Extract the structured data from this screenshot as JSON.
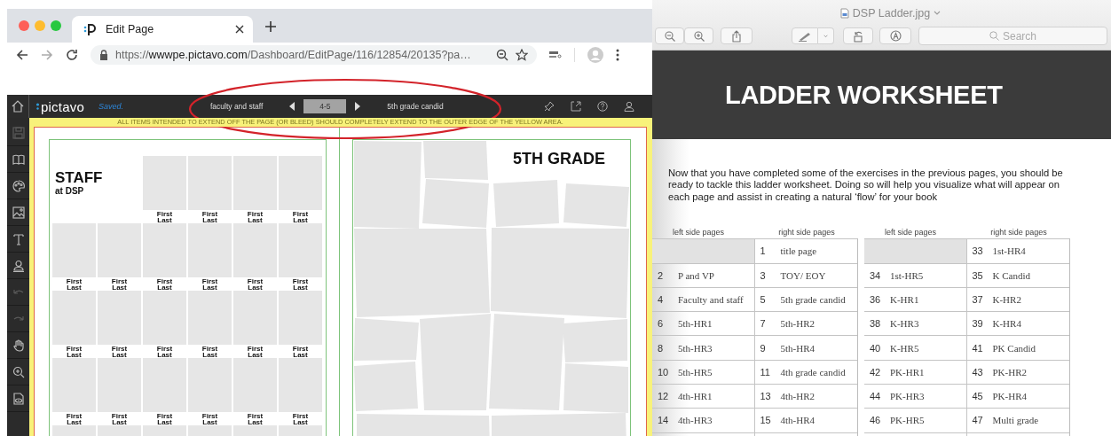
{
  "browser": {
    "tabs": [
      {
        "title": "Edit Page",
        "selected": true
      }
    ],
    "url": {
      "scheme": "https://",
      "host": "wwwpe.pictavo.com",
      "path": "/Dashboard/EditPage/116/12854/20135?pa…"
    }
  },
  "editor": {
    "logo": "pictavo",
    "status": "Saved.",
    "prev_page": "faculty and staff",
    "page": "4-5",
    "next_page": "5th grade candid",
    "bleed_notice": "ALL ITEMS INTENDED TO EXTEND OFF THE PAGE (OR BLEED) SHOULD COMPLETELY EXTEND TO THE OUTER EDGE OF THE YELLOW AREA.",
    "tools": [
      {
        "kind": "save",
        "disabled": true
      },
      {
        "kind": "book",
        "disabled": false
      },
      {
        "kind": "palette",
        "disabled": false
      },
      {
        "kind": "image",
        "disabled": false
      },
      {
        "kind": "text",
        "disabled": false
      },
      {
        "kind": "person",
        "disabled": false
      },
      {
        "kind": "undo",
        "disabled": true
      },
      {
        "kind": "redo",
        "disabled": true
      },
      {
        "kind": "hand",
        "disabled": false
      },
      {
        "kind": "zoom",
        "disabled": false
      },
      {
        "kind": "preview",
        "disabled": false
      }
    ],
    "left_page": {
      "title": "STAFF",
      "subtitle": "at DSP",
      "rows": [
        [
          "",
          "",
          {
            "kind": "captioned",
            "caption": "First Last"
          },
          {
            "kind": "captioned",
            "caption": "First Last"
          },
          {
            "kind": "captioned",
            "caption": "First Last"
          },
          {
            "kind": "captioned",
            "caption": "First Last"
          }
        ],
        [
          {
            "kind": "captioned",
            "caption": "First Last"
          },
          {
            "kind": "captioned",
            "caption": "First Last"
          },
          {
            "kind": "captioned",
            "caption": "First Last"
          },
          {
            "kind": "captioned",
            "caption": "First Last"
          },
          {
            "kind": "captioned",
            "caption": "First Last"
          },
          {
            "kind": "captioned",
            "caption": "First Last"
          }
        ],
        [
          {
            "kind": "captioned",
            "caption": "First Last"
          },
          {
            "kind": "captioned",
            "caption": "First Last"
          },
          {
            "kind": "captioned",
            "caption": "First Last"
          },
          {
            "kind": "captioned",
            "caption": "First Last"
          },
          {
            "kind": "captioned",
            "caption": "First Last"
          },
          {
            "kind": "captioned",
            "caption": "First Last"
          }
        ],
        [
          {
            "kind": "captioned",
            "caption": "First Last"
          },
          {
            "kind": "captioned",
            "caption": "First Last"
          },
          {
            "kind": "captioned",
            "caption": "First Last"
          },
          {
            "kind": "captioned",
            "caption": "First Last"
          },
          {
            "kind": "captioned",
            "caption": "First Last"
          },
          {
            "kind": "captioned",
            "caption": "First Last"
          }
        ],
        [
          {
            "kind": "plain"
          },
          {
            "kind": "plain"
          },
          {
            "kind": "plain"
          },
          {
            "kind": "plain"
          },
          {
            "kind": "plain"
          },
          {
            "kind": "plain"
          }
        ]
      ]
    },
    "right_page": {
      "title": "5TH GRADE"
    }
  },
  "preview": {
    "file_title": "DSP Ladder.jpg",
    "search": {
      "placeholder": "Search"
    },
    "heading": "LADDER WORKSHEET",
    "paragraph": "Now that you have completed some of the exercises in the previous pages, you should be ready to tackle this ladder worksheet. Doing so will help you visualize what will appear on each page and assist in creating a natural ‘flow’ for your book",
    "tables": [
      {
        "columns": [
          "left side pages",
          "right side pages"
        ],
        "rows": [
          {
            "right": {
              "number": "1",
              "label": "title page"
            }
          },
          {
            "left": {
              "number": "2",
              "label": "P and VP"
            },
            "right": {
              "number": "3",
              "label": "TOY/ EOY"
            }
          },
          {
            "left": {
              "number": "4",
              "label": "Faculty and staff"
            },
            "right": {
              "number": "5",
              "label": "5th grade candid"
            }
          },
          {
            "left": {
              "number": "6",
              "label": "5th-HR1"
            },
            "right": {
              "number": "7",
              "label": "5th-HR2"
            }
          },
          {
            "left": {
              "number": "8",
              "label": "5th-HR3"
            },
            "right": {
              "number": "9",
              "label": "5th-HR4"
            }
          },
          {
            "left": {
              "number": "10",
              "label": "5th-HR5"
            },
            "right": {
              "number": "11",
              "label": "4th grade candid"
            }
          },
          {
            "left": {
              "number": "12",
              "label": "4th-HR1"
            },
            "right": {
              "number": "13",
              "label": "4th-HR2"
            }
          },
          {
            "left": {
              "number": "14",
              "label": "4th-HR3"
            },
            "right": {
              "number": "15",
              "label": "4th-HR4"
            }
          }
        ]
      },
      {
        "columns": [
          "left side pages",
          "right side pages"
        ],
        "rows": [
          {
            "right": {
              "number": "33",
              "label": "1st-HR4"
            }
          },
          {
            "left": {
              "number": "34",
              "label": "1st-HR5"
            },
            "right": {
              "number": "35",
              "label": "K Candid"
            }
          },
          {
            "left": {
              "number": "36",
              "label": "K-HR1"
            },
            "right": {
              "number": "37",
              "label": "K-HR2"
            }
          },
          {
            "left": {
              "number": "38",
              "label": "K-HR3"
            },
            "right": {
              "number": "39",
              "label": "K-HR4"
            }
          },
          {
            "left": {
              "number": "40",
              "label": "K-HR5"
            },
            "right": {
              "number": "41",
              "label": "PK Candid"
            }
          },
          {
            "left": {
              "number": "42",
              "label": "PK-HR1"
            },
            "right": {
              "number": "43",
              "label": "PK-HR2"
            }
          },
          {
            "left": {
              "number": "44",
              "label": "PK-HR3"
            },
            "right": {
              "number": "45",
              "label": "PK-HR4"
            }
          },
          {
            "left": {
              "number": "46",
              "label": "PK-HR5"
            },
            "right": {
              "number": "47",
              "label": "Multi grade"
            }
          }
        ]
      }
    ]
  }
}
